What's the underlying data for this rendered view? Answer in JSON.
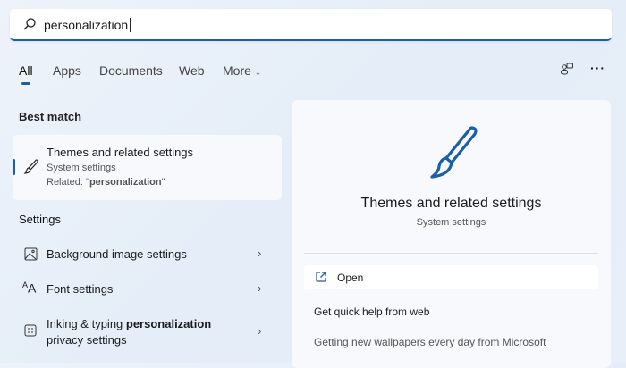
{
  "search": {
    "value": "personalization"
  },
  "tabs": [
    {
      "label": "All"
    },
    {
      "label": "Apps"
    },
    {
      "label": "Documents"
    },
    {
      "label": "Web"
    },
    {
      "label": "More"
    }
  ],
  "best_match": {
    "heading": "Best match",
    "title": "Themes and related settings",
    "subtitle": "System settings",
    "related_prefix": "Related: \"",
    "related_term": "personalization",
    "related_suffix": "\""
  },
  "settings": {
    "heading": "Settings",
    "items": [
      {
        "label": "Background image settings",
        "icon": "image-icon"
      },
      {
        "label": "Font settings",
        "icon": "font-icon"
      },
      {
        "label_pre": "Inking & typing ",
        "label_bold": "personalization",
        "label_post": "privacy settings",
        "icon": "keyboard-icon"
      }
    ]
  },
  "preview": {
    "title": "Themes and related settings",
    "subtitle": "System settings",
    "open": "Open",
    "help": "Get quick help from web",
    "link": "Getting new wallpapers every day from Microsoft"
  },
  "colors": {
    "accent": "#1a5fa8"
  }
}
